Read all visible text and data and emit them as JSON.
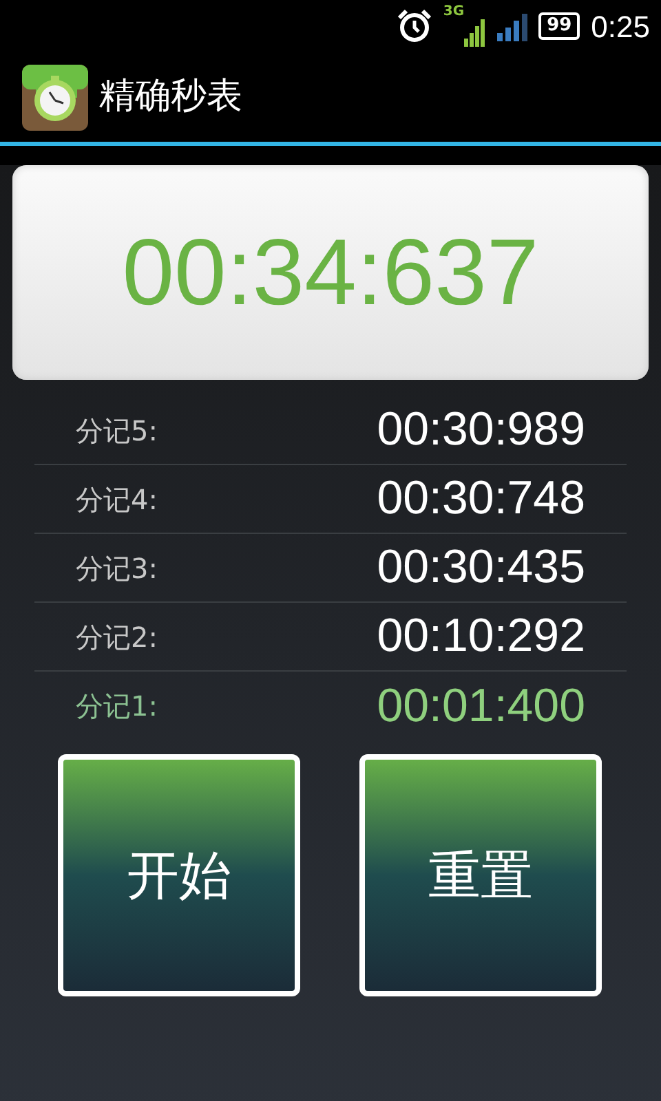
{
  "status_bar": {
    "network": "3G",
    "battery": "99",
    "time": "0:25"
  },
  "app_bar": {
    "title": "精确秒表"
  },
  "timer": {
    "display": "00:34:637"
  },
  "laps": [
    {
      "label": "分记5:",
      "time": "00:30:989",
      "faded": false
    },
    {
      "label": "分记4:",
      "time": "00:30:748",
      "faded": false
    },
    {
      "label": "分记3:",
      "time": "00:30:435",
      "faded": false
    },
    {
      "label": "分记2:",
      "time": "00:10:292",
      "faded": false
    },
    {
      "label": "分记1:",
      "time": "00:01:400",
      "faded": true
    }
  ],
  "buttons": [
    {
      "label": "开始"
    },
    {
      "label": "重置"
    }
  ]
}
